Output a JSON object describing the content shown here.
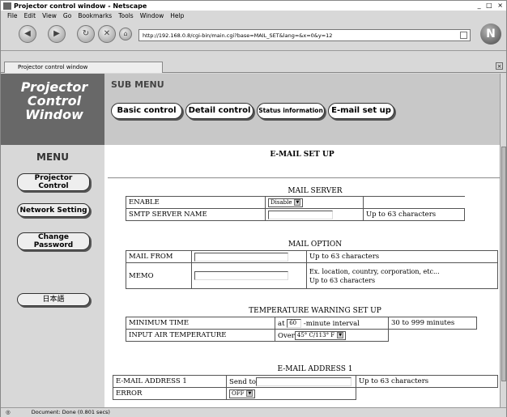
{
  "browser": {
    "title": "Projector control window - Netscape",
    "window_controls": "_ □ ×",
    "menus": [
      "File",
      "Edit",
      "View",
      "Go",
      "Bookmarks",
      "Tools",
      "Window",
      "Help"
    ],
    "url": "http://192.168.0.8/cgi-bin/main.cgi?base=MAIL_SET&lang=&x=0&y=12",
    "tab_label": "Projector control window",
    "status_text": "Document: Done (0.801 secs)"
  },
  "sidebar": {
    "title_line1": "Projector",
    "title_line2": "Control",
    "title_line3": "Window",
    "menu_heading": "MENU",
    "items": [
      {
        "label": "Projector Control"
      },
      {
        "label": "Network Setting"
      },
      {
        "label": "Change Password"
      },
      {
        "label": "日本語"
      }
    ]
  },
  "submenu": {
    "heading": "SUB MENU",
    "buttons": [
      {
        "label": "Basic control"
      },
      {
        "label": "Detail control"
      },
      {
        "label": "Status information"
      },
      {
        "label": "E-mail set up"
      }
    ]
  },
  "page": {
    "heading": "E-MAIL SET UP",
    "mail_server": {
      "heading": "MAIL SERVER",
      "enable_label": "ENABLE",
      "enable_value": "Disable",
      "smtp_label": "SMTP SERVER NAME",
      "smtp_value": "",
      "smtp_hint": "Up to 63 characters"
    },
    "mail_option": {
      "heading": "MAIL OPTION",
      "from_label": "MAIL FROM",
      "from_value": "",
      "from_hint": "Up to 63 characters",
      "memo_label": "MEMO",
      "memo_value": "",
      "memo_hint_line1": "Ex. location, country, corporation, etc...",
      "memo_hint_line2": "Up to 63 characters"
    },
    "temperature": {
      "heading": "TEMPERATURE WARNING SET UP",
      "min_time_label": "MINIMUM TIME",
      "at_text": "at",
      "min_time_value": "60",
      "interval_text": "-minute interval",
      "min_time_hint": "30 to 999 minutes",
      "air_temp_label": "INPUT AIR TEMPERATURE",
      "over_text": "Over",
      "air_temp_value": "45° C/113° F"
    },
    "address1": {
      "heading": "E-MAIL ADDRESS 1",
      "label": "E-MAIL ADDRESS 1",
      "send_to_text": "Send to",
      "value": "",
      "hint": "Up to 63 characters",
      "error_label": "ERROR",
      "error_value": "OFF"
    }
  },
  "colors": {
    "sidebar_top": "#686868",
    "top_panel": "#c8c8c8",
    "side_menu": "#d8d8d8"
  }
}
